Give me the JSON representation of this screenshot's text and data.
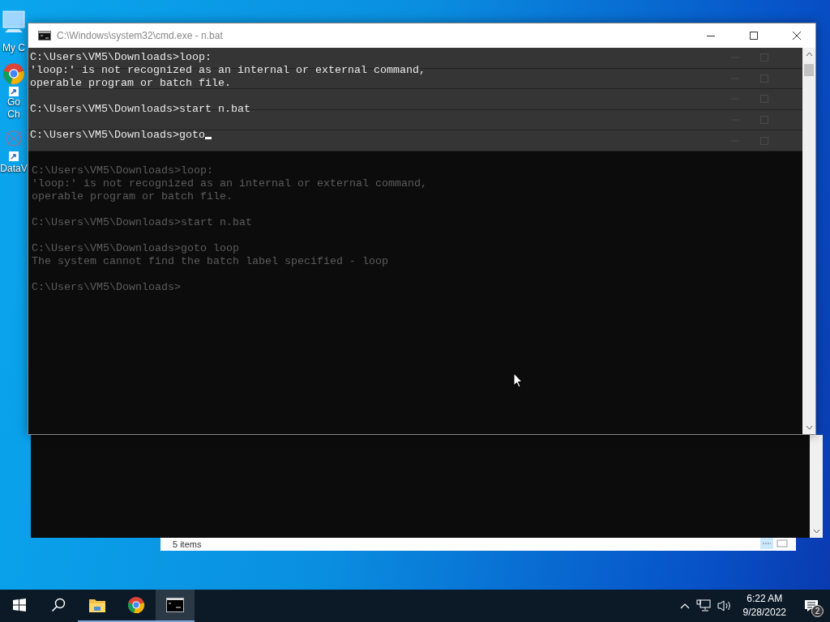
{
  "desktop_icons": [
    {
      "kind": "computer",
      "lines": [
        "My C"
      ]
    },
    {
      "kind": "chrome",
      "lines": [
        "Go",
        "Ch"
      ]
    },
    {
      "kind": "app",
      "lines": [
        "DataV"
      ]
    }
  ],
  "explorer_window": {
    "status": "5 items"
  },
  "back_console": {
    "blocks": [
      [
        "C:\\Users\\VM5\\Downloads>loop:",
        "'loop:' is not recognized as an internal or external command,",
        "operable program or batch file."
      ],
      [
        "C:\\Users\\VM5\\Downloads>start n.bat"
      ],
      [
        "C:\\Users\\VM5\\Downloads>goto loop",
        "The system cannot find the batch label specified - loop"
      ],
      [
        "C:\\Users\\VM5\\Downloads>"
      ]
    ]
  },
  "window": {
    "title": "C:\\Windows\\system32\\cmd.exe - n.bat",
    "cursor": true,
    "blocks": [
      [
        "C:\\Users\\VM5\\Downloads>loop:",
        "'loop:' is not recognized as an internal or external command,",
        "operable program or batch file."
      ],
      [
        "C:\\Users\\VM5\\Downloads>start n.bat"
      ],
      [
        "C:\\Users\\VM5\\Downloads>goto"
      ]
    ]
  },
  "taskbar": {
    "apps": [
      {
        "kind": "explorer",
        "selected": false
      },
      {
        "kind": "chrome",
        "selected": false
      },
      {
        "kind": "cmd",
        "selected": true
      }
    ],
    "time": "6:22 AM",
    "date": "9/28/2022",
    "notifications": "2"
  }
}
